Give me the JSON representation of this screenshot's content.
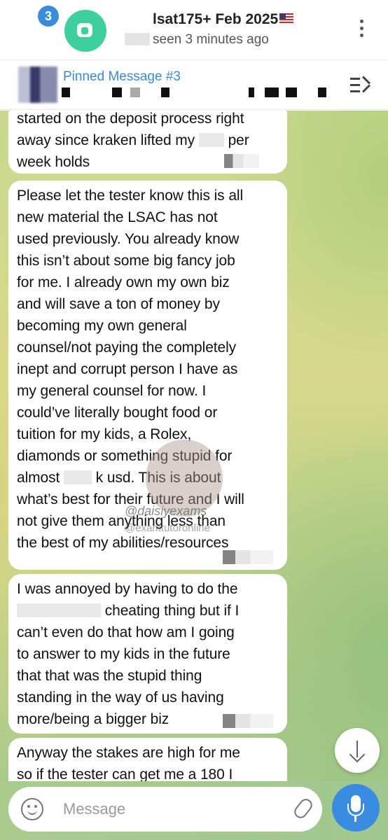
{
  "header": {
    "unread_badge": "3",
    "title": "lsat175+ Feb 2025",
    "subtitle": "seen 3 minutes ago",
    "menu_icon": "more-vertical-icon"
  },
  "pinned": {
    "title": "Pinned Message #3",
    "icon": "pin-list-icon"
  },
  "messages": [
    {
      "lines": [
        "started on the deposit process right",
        "away since kraken lifted my ",
        "week holds"
      ],
      "line2_after": "per"
    },
    {
      "lines": [
        "Please let the tester know this is all",
        "new material the LSAC has not",
        "used previously. You already know",
        "this isn’t about some big fancy job",
        "for me. I already own my own biz",
        "and will save a ton of money by",
        "becoming my own general",
        "counsel/not paying the completely",
        "inept and corrupt person I have as",
        "my general counsel for now. I",
        "could’ve literally bought food or",
        "tuition for my kids, a Rolex,",
        "diamonds or something stupid for",
        "almost",
        "what’s best for their future and I will",
        "not give them anything less than",
        "the best of my abilities/resources"
      ],
      "line14_after": "k usd. This is about"
    },
    {
      "lines": [
        "I was annoyed by having to do the",
        "cheating thing but if I",
        "can’t even do that how am I going",
        "to answer to my kids in the future",
        "that that was the stupid thing",
        "standing in the way of us having",
        "more/being a bigger biz"
      ]
    },
    {
      "lines": [
        "Anyway the stakes are high for me",
        "so if the tester can get me a 180 I"
      ]
    }
  ],
  "watermark": {
    "line1": "@daisiyexams",
    "line2": "@examtutoronline"
  },
  "composer": {
    "placeholder": "Message",
    "emoji_icon": "emoji-icon",
    "attach_icon": "paperclip-icon",
    "mic_icon": "microphone-icon"
  },
  "scroll_icon": "arrow-down-icon",
  "colors": {
    "accent": "#3a8ce0",
    "badge": "#3b8cdb",
    "avatar": "#3fcf9e"
  }
}
